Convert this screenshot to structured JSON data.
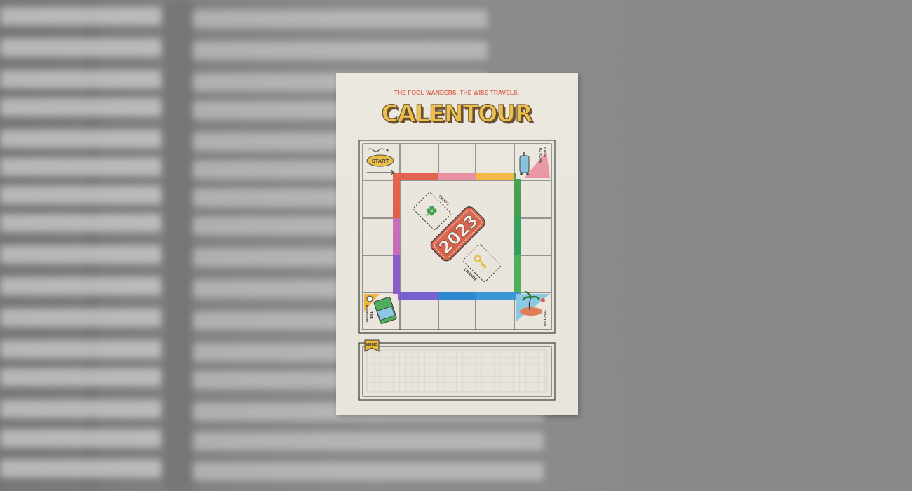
{
  "poster": {
    "tagline": "THE FOOL WANDERS, THE WISE TRAVELS.",
    "title": "CALENTOUR",
    "year": "2023",
    "start_label": "START",
    "lucky_label": "LUCKY",
    "chance_label": "CHANCE",
    "boarding_label": "BOARDING",
    "time_label": "TIME",
    "vacation_label": "VACATION",
    "back_label": "BACK",
    "home_label": "TO HOME",
    "memo_label": "MEMO"
  },
  "colors": {
    "wall": "#8d8d8d",
    "paper": "#e9e5dc",
    "tagline": "#d8573e",
    "title_fill": "#e9b83a",
    "title_stroke": "#5a3d1a",
    "year_box": "#d6604a",
    "track_top": [
      "#e05a45",
      "#e7889b",
      "#f0b33c"
    ],
    "track_right": "#3e9b47",
    "track_bottom": [
      "#7a5fd0",
      "#2f8ad1"
    ],
    "track_left": [
      "#e05a45",
      "#c46bb8",
      "#8c5cc7"
    ]
  },
  "icons": {
    "lucky": "clover-icon",
    "chance": "key-icon",
    "corner_top_right": "luggage-icon",
    "corner_bottom_left": "boarding-pass-icon",
    "corner_bottom_right": "palm-island-icon",
    "start": "arrow-icon"
  }
}
